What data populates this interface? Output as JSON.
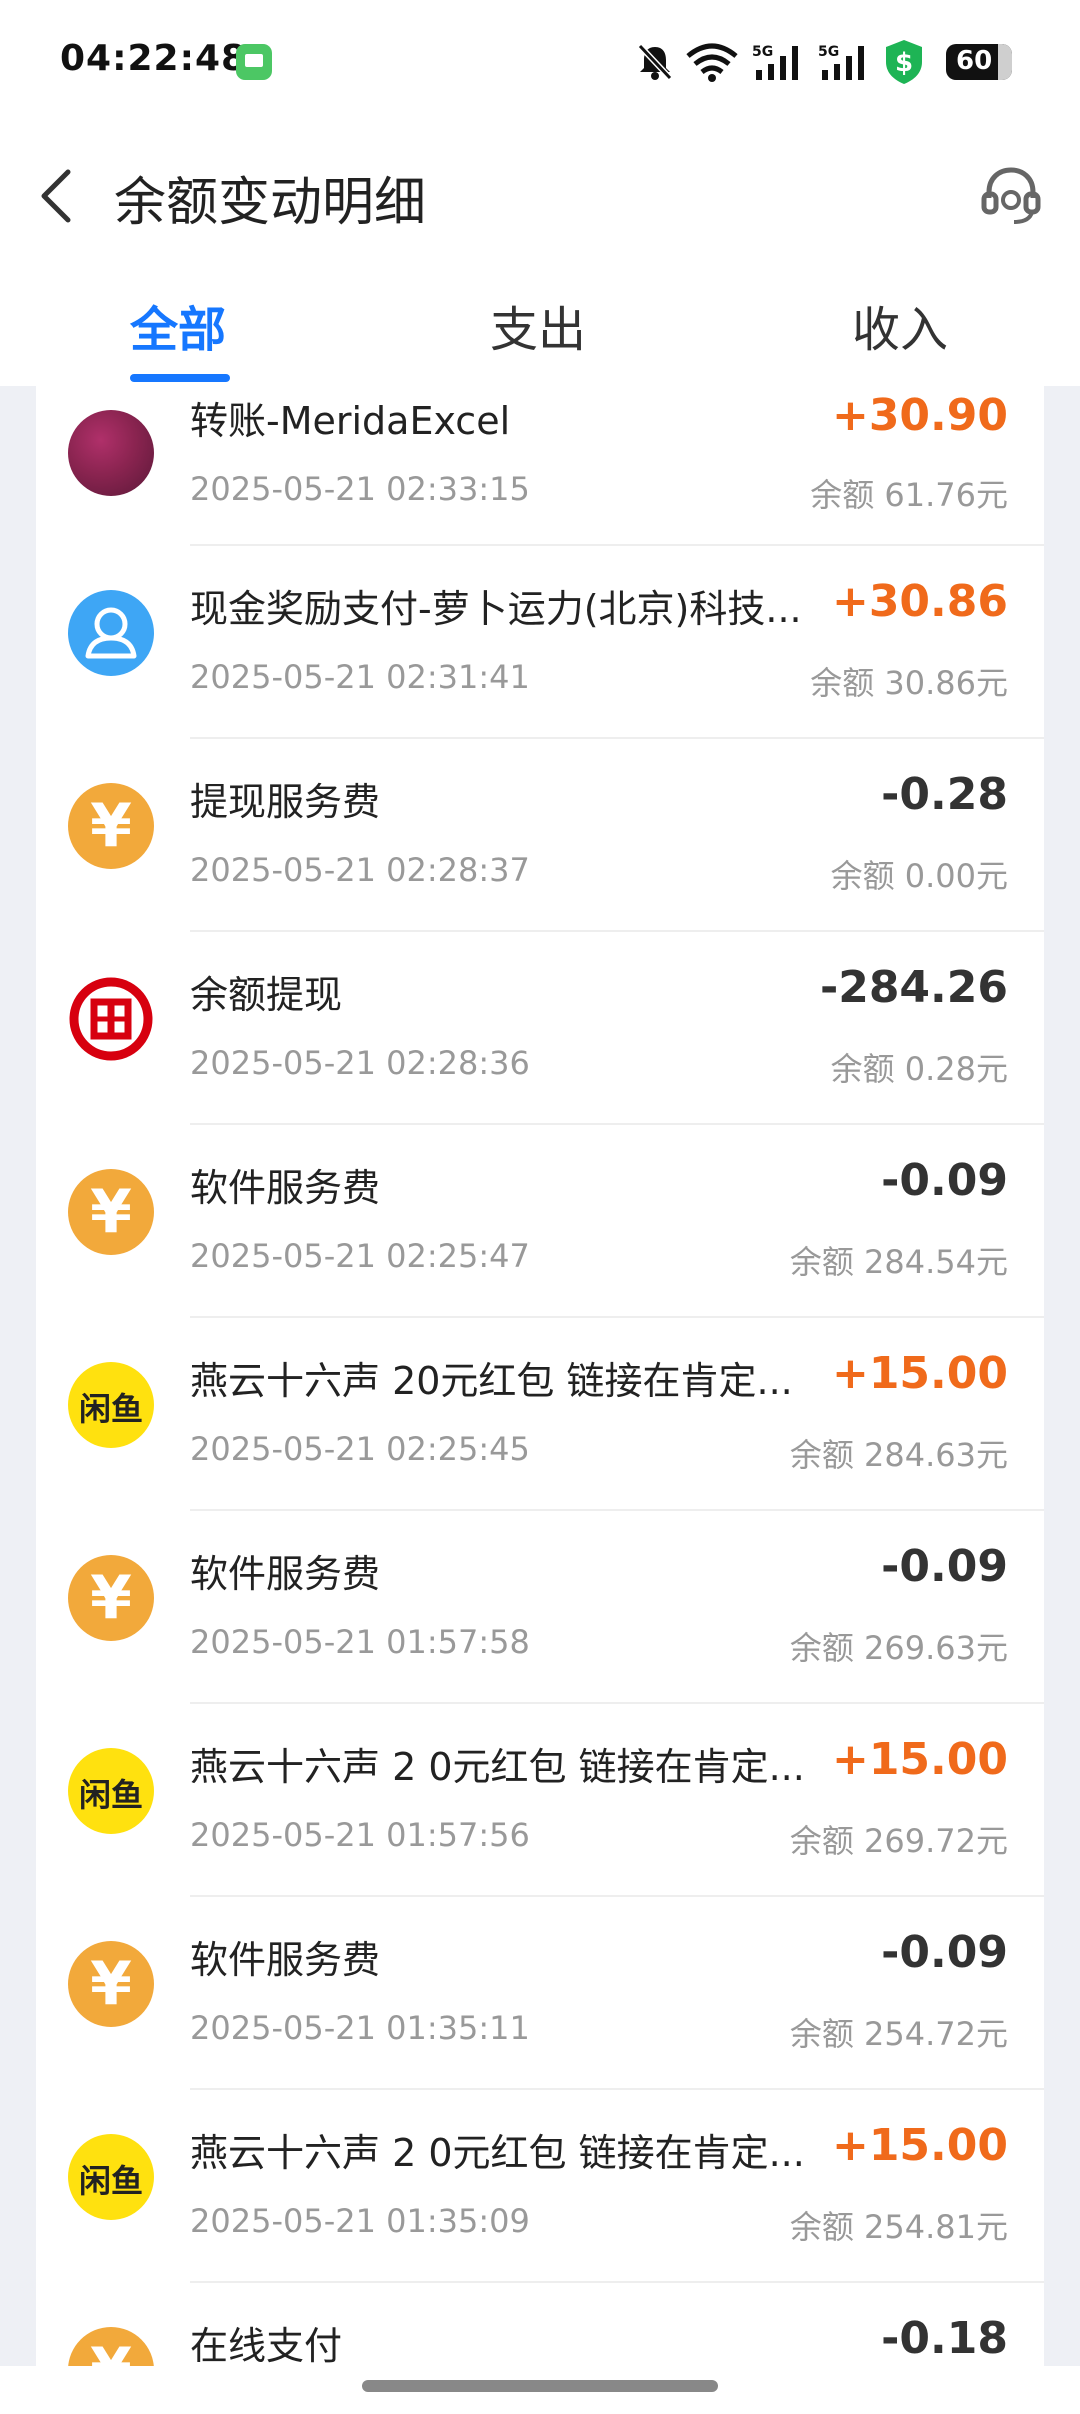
{
  "status_bar": {
    "time": "04:22:48",
    "battery": "60"
  },
  "header": {
    "title": "余额变动明细"
  },
  "tabs": [
    {
      "label": "全部",
      "active": true
    },
    {
      "label": "支出",
      "active": false
    },
    {
      "label": "收入",
      "active": false
    }
  ],
  "colors": {
    "accent": "#1677ff",
    "income": "#f06a1b",
    "expense": "#333333"
  },
  "transactions": [
    {
      "icon": "user-photo-avatar",
      "title": "转账-MeridaExcel",
      "time": "2025-05-21 02:33:15",
      "amount": "+30.90",
      "balance": "余额 61.76元"
    },
    {
      "icon": "person-avatar-icon",
      "title": "现金奖励支付-萝卜运力(北京)科技...",
      "time": "2025-05-21 02:31:41",
      "amount": "+30.86",
      "balance": "余额 30.86元"
    },
    {
      "icon": "yuan-icon",
      "icon_text": "¥",
      "title": "提现服务费",
      "time": "2025-05-21 02:28:37",
      "amount": "-0.28",
      "balance": "余额 0.00元"
    },
    {
      "icon": "icbc-bank-icon",
      "title": "余额提现",
      "time": "2025-05-21 02:28:36",
      "amount": "-284.26",
      "balance": "余额 0.28元"
    },
    {
      "icon": "yuan-icon",
      "icon_text": "¥",
      "title": "软件服务费",
      "time": "2025-05-21 02:25:47",
      "amount": "-0.09",
      "balance": "余额 284.54元"
    },
    {
      "icon": "xianyu-icon",
      "icon_text": "闲鱼",
      "title": "燕云十六声 20元红包 链接在肯定...",
      "time": "2025-05-21 02:25:45",
      "amount": "+15.00",
      "balance": "余额 284.63元"
    },
    {
      "icon": "yuan-icon",
      "icon_text": "¥",
      "title": "软件服务费",
      "time": "2025-05-21 01:57:58",
      "amount": "-0.09",
      "balance": "余额 269.63元"
    },
    {
      "icon": "xianyu-icon",
      "icon_text": "闲鱼",
      "title": "燕云十六声 2 0元红包 链接在肯定...",
      "time": "2025-05-21 01:57:56",
      "amount": "+15.00",
      "balance": "余额 269.72元"
    },
    {
      "icon": "yuan-icon",
      "icon_text": "¥",
      "title": "软件服务费",
      "time": "2025-05-21 01:35:11",
      "amount": "-0.09",
      "balance": "余额 254.72元"
    },
    {
      "icon": "xianyu-icon",
      "icon_text": "闲鱼",
      "title": "燕云十六声 2 0元红包 链接在肯定...",
      "time": "2025-05-21 01:35:09",
      "amount": "+15.00",
      "balance": "余额 254.81元"
    },
    {
      "icon": "yuan-icon",
      "icon_text": "¥",
      "title": "在线支付",
      "time": "",
      "amount": "-0.18",
      "balance": ""
    }
  ]
}
